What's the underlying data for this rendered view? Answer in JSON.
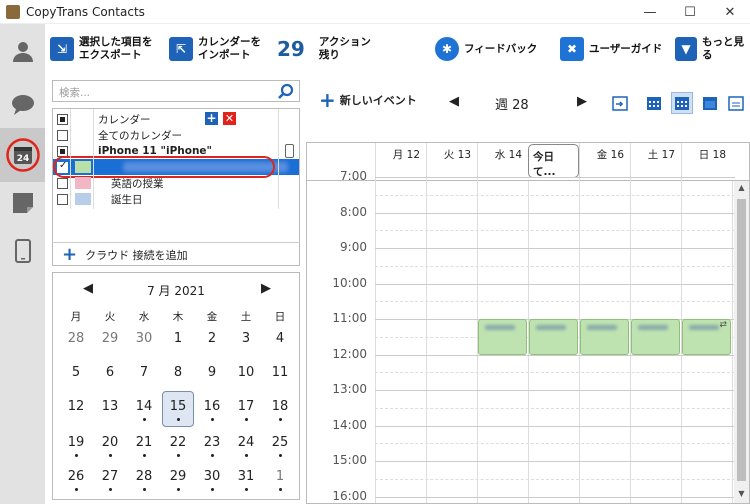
{
  "window": {
    "title": "CopyTrans Contacts"
  },
  "toolbar": {
    "export_label": "選択した項目を\nエクスポート",
    "import_label": "カレンダーを\nインポート",
    "actions_count": "29",
    "actions_label": "アクション\n残り",
    "feedback_label": "フィードバック",
    "guide_label": "ユーザーガイド",
    "more_label": "もっと見る"
  },
  "search": {
    "placeholder": "検索..."
  },
  "calendars": {
    "header": "カレンダー",
    "all": "全てのカレンダー",
    "device": "iPhone 11 \"iPhone\"",
    "items": [
      {
        "label": "英語の授業",
        "color": "#f2b7c4"
      },
      {
        "label": "誕生日",
        "color": "#b8cde8"
      }
    ]
  },
  "cloud": {
    "label": "クラウド 接続を追加"
  },
  "minical": {
    "month_label": "7 月  2021",
    "weekdays": [
      "月",
      "火",
      "水",
      "木",
      "金",
      "土",
      "日"
    ],
    "weeks": [
      [
        "28",
        "29",
        "30",
        "1",
        "2",
        "3",
        "4"
      ],
      [
        "5",
        "6",
        "7",
        "8",
        "9",
        "10",
        "11"
      ],
      [
        "12",
        "13",
        "14",
        "15",
        "16",
        "17",
        "18"
      ],
      [
        "19",
        "20",
        "21",
        "22",
        "23",
        "24",
        "25"
      ],
      [
        "26",
        "27",
        "28",
        "29",
        "30",
        "31",
        "1"
      ]
    ]
  },
  "view": {
    "new_event_label": "新しいイベント",
    "week_label": "週 28"
  },
  "days": [
    {
      "label": "月 12"
    },
    {
      "label": "火 13"
    },
    {
      "label": "水 14"
    },
    {
      "label": "今日 て..."
    },
    {
      "label": "金 16"
    },
    {
      "label": "土 17"
    },
    {
      "label": "日 18"
    }
  ],
  "hours": [
    "7:00",
    "8:00",
    "9:00",
    "10:00",
    "11:00",
    "12:00",
    "13:00",
    "14:00",
    "15:00",
    "16:00"
  ],
  "colors": {
    "accent": "#1a6fd4",
    "event": "#bfe3b0",
    "highlight": "#e0241b"
  }
}
